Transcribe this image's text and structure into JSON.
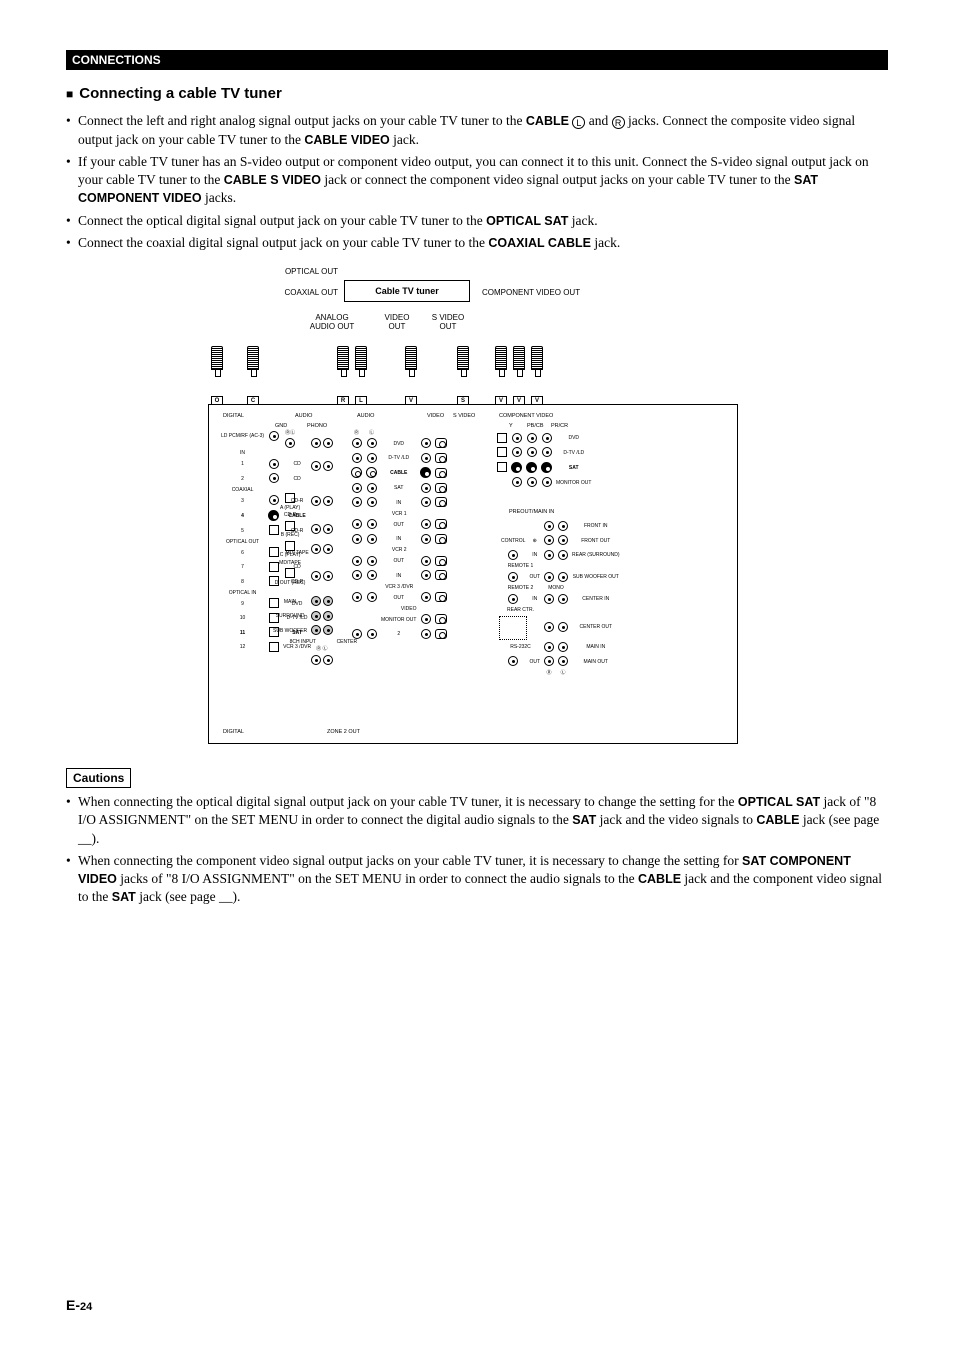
{
  "header": "CONNECTIONS",
  "section_title": "Connecting a cable TV tuner",
  "bullets": [
    {
      "pre": "Connect the left and right analog signal output jacks on your cable TV tuner to the ",
      "b1": "CABLE",
      "mid1": " ",
      "circ1": "L",
      "mid2": " and ",
      "circ2": "R",
      "mid3": " jacks. Connect the composite video signal output jack on your cable TV tuner to the ",
      "b2": "CABLE VIDEO",
      "post": " jack."
    },
    {
      "pre": "If your cable TV tuner has an S-video output or component video output, you can connect it to this unit. Connect the S-video signal output jack on your cable TV tuner to the ",
      "b1": "CABLE S VIDEO",
      "mid1": " jack or connect the component video signal output jacks on your cable TV tuner to the ",
      "b2": "SAT COMPONENT VIDEO",
      "post": " jacks."
    },
    {
      "pre": "Connect the optical digital signal output jack on your cable TV tuner to the ",
      "b1": "OPTICAL SAT",
      "post": " jack."
    },
    {
      "pre": "Connect the coaxial digital signal output jack on your cable TV tuner to the ",
      "b1": "COAXIAL CABLE",
      "post": " jack."
    }
  ],
  "diagram": {
    "tuner_box": "Cable TV tuner",
    "labels": {
      "optical_out": "OPTICAL OUT",
      "coaxial_out": "COAXIAL OUT",
      "component_out": "COMPONENT VIDEO OUT",
      "analog_audio_out": "ANALOG AUDIO OUT",
      "video_out": "VIDEO OUT",
      "svideo_out": "S VIDEO OUT"
    },
    "plugs": {
      "O": "O",
      "C": "C",
      "R": "R",
      "L": "L",
      "V": "V",
      "S": "S"
    },
    "panel_groups": {
      "digital": "DIGITAL",
      "audio": "AUDIO",
      "phono": "PHONO",
      "gnd": "GND",
      "video": "VIDEO",
      "svideo": "S VIDEO",
      "component_video": "COMPONENT VIDEO",
      "preout_main_in": "PREOUT/MAIN IN",
      "monitor_out": "MONITOR OUT",
      "control": "CONTROL",
      "zone2_out": "ZONE 2  OUT",
      "8ch_input": "8CH INPUT",
      "center_txt": "CENTER",
      "main": "MAIN",
      "surround": "SURROUND",
      "subwoofer": "SUB WOOFER",
      "mono": "MONO",
      "remote1": "REMOTE 1",
      "remote2": "REMOTE 2",
      "rs232c": "RS-232C",
      "rear_ctr": "REAR CTR.",
      "center_in": "CENTER IN",
      "center_out": "CENTER OUT",
      "main_in": "MAIN IN",
      "main_out": "MAIN OUT",
      "front_in": "FRONT IN",
      "front_out": "FRONT OUT",
      "rear_surround": "REAR (SURROUND)",
      "sub_woofer_out": "SUB WOOFER OUT",
      "in_out": {
        "in": "IN",
        "out": "OUT"
      },
      "y": "Y",
      "pb": "PB/CB",
      "pr": "PR/CR"
    },
    "row_labels": {
      "ld_pcm_rf": "LD PCM/RF (AC-3)",
      "coaxial": "COAXIAL",
      "optical_out_lbl": "OPTICAL OUT",
      "optical_in_lbl": "OPTICAL IN",
      "cd1": "CD",
      "cd2": "CD",
      "cdr3": "CD-R",
      "cable4": "CABLE",
      "cdr5": "CD-R",
      "mdtape6": "MD/ TAPE",
      "cd7": "CD",
      "cdr8": "CD-R",
      "dvd9": "DVD",
      "dtvld10": "D-TV /LD",
      "sat11": "SAT",
      "vcr3_dvr12": "VCR 3 /DVR",
      "tuner_a": "A (PLAY)",
      "cdr_b": "B (REC)",
      "md_c": "C (PLAY)",
      "out_d": "D OUT (REC)",
      "dvd": "DVD",
      "dtvld": "D-TV /LD",
      "sat": "SAT",
      "vcr1": "VCR 1",
      "vcr2": "VCR 2",
      "vcr3dvr": "VCR 3 /DVR",
      "cable_bold": "CABLE",
      "sat_bold": "SAT",
      "monitor_out_rows": "MONITOR OUT",
      "n1": "1",
      "n2": "2",
      "n3": "3",
      "n4": "4",
      "n5": "5",
      "n6": "6",
      "n7": "7",
      "n8": "8",
      "n9": "9",
      "n10": "10",
      "n11": "11",
      "n12": "12"
    }
  },
  "cautions_label": "Cautions",
  "cautions": [
    {
      "pre": "When connecting the optical digital signal output jack on your cable TV tuner, it is necessary to change the setting for the ",
      "b1": "OPTICAL SAT",
      "mid1": " jack of \"8 I/O ASSIGNMENT\" on the SET MENU in order to connect the digital audio signals to the ",
      "b2": "SAT",
      "mid2": " jack and the video signals to ",
      "b3": "CABLE",
      "post": " jack (see page __)."
    },
    {
      "pre": "When connecting the component video signal output jacks on your cable TV tuner, it is necessary to change the setting for ",
      "b1": "SAT COMPONENT VIDEO",
      "mid1": " jacks of \"8 I/O ASSIGNMENT\" on the SET MENU in order to connect the audio signals to the ",
      "b2": "CABLE",
      "mid2": " jack and the component video signal to the ",
      "b3": "SAT",
      "post": " jack (see page __)."
    }
  ],
  "page_number": {
    "prefix": "E-",
    "num": "24"
  }
}
